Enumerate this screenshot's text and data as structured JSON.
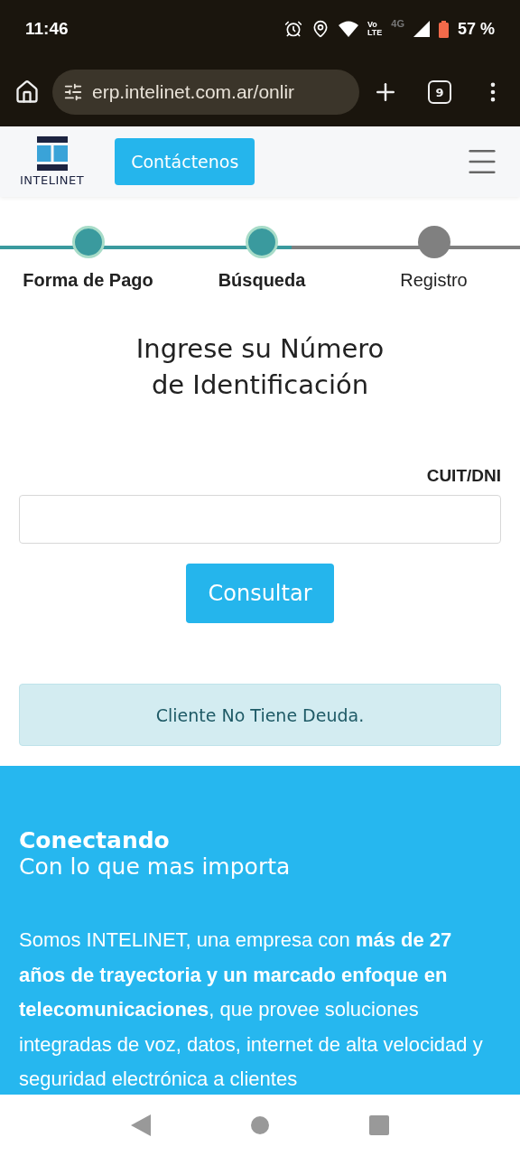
{
  "status_bar": {
    "time": "11:46",
    "volte": [
      "Vo",
      "LTE"
    ],
    "network": "4G",
    "battery": "57 %"
  },
  "browser": {
    "url": "erp.intelinet.com.ar/onlir",
    "tab_count": "9"
  },
  "header": {
    "logo_text": "INTELINET",
    "contact_button": "Contáctenos"
  },
  "steps": [
    {
      "label": "Forma de Pago",
      "completed": true
    },
    {
      "label": "Búsqueda",
      "completed": true
    },
    {
      "label": "Registro",
      "completed": false
    }
  ],
  "form": {
    "heading": "Ingrese su Número de Identificación",
    "field_label": "CUIT/DNI",
    "submit": "Consultar"
  },
  "alert": "Cliente No Tiene Deuda.",
  "about": {
    "title": "Conectando",
    "subtitle": "Con lo que mas importa",
    "text": "Somos INTELINET, una empresa con **más de 27 años de trayectoria y un marcado enfoque en telecomunicaciones**, que provee soluciones integradas de voz, datos, internet de alta velocidad y seguridad electrónica a clientes"
  }
}
